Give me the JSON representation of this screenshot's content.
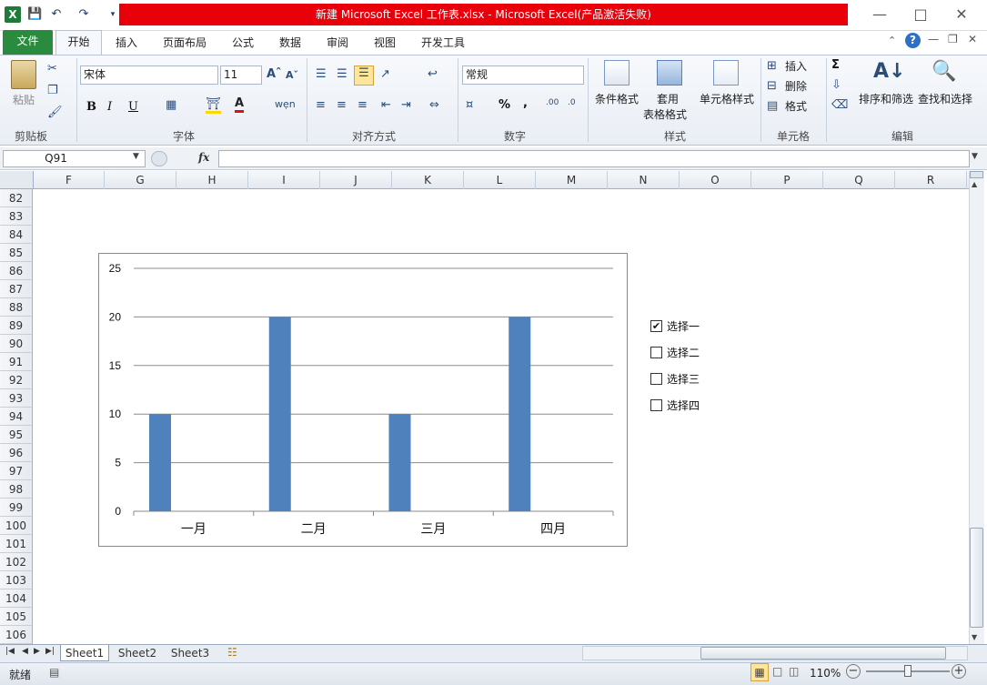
{
  "window": {
    "title": "新建 Microsoft Excel 工作表.xlsx - Microsoft Excel(产品激活失败)"
  },
  "tabs": [
    {
      "label": "文件"
    },
    {
      "label": "开始"
    },
    {
      "label": "插入"
    },
    {
      "label": "页面布局"
    },
    {
      "label": "公式"
    },
    {
      "label": "数据"
    },
    {
      "label": "审阅"
    },
    {
      "label": "视图"
    },
    {
      "label": "开发工具"
    }
  ],
  "ribbon": {
    "clipboard": {
      "paste": "粘贴",
      "group": "剪贴板"
    },
    "font": {
      "name": "宋体",
      "size": "11",
      "bold": "B",
      "italic": "I",
      "underline": "U",
      "group": "字体"
    },
    "align": {
      "group": "对齐方式"
    },
    "number": {
      "format": "常规",
      "percent": "%",
      "comma": ",",
      "group": "数字"
    },
    "styles": {
      "cond": "条件格式",
      "table1": "套用",
      "table2": "表格格式",
      "cell": "单元格样式",
      "group": "样式"
    },
    "cells": {
      "insert": "插入",
      "delete": "删除",
      "format": "格式",
      "group": "单元格"
    },
    "edit": {
      "sort": "排序和筛选",
      "find": "查找和选择",
      "group": "编辑"
    }
  },
  "formula_bar": {
    "name_box": "Q91",
    "fx": "fx",
    "value": ""
  },
  "columns": [
    "F",
    "G",
    "H",
    "I",
    "J",
    "K",
    "L",
    "M",
    "N",
    "O",
    "P",
    "Q",
    "R"
  ],
  "rows": [
    "82",
    "83",
    "84",
    "85",
    "86",
    "87",
    "88",
    "89",
    "90",
    "91",
    "92",
    "93",
    "94",
    "95",
    "96",
    "97",
    "98",
    "99",
    "100",
    "101",
    "102",
    "103",
    "104",
    "105",
    "106"
  ],
  "checkboxes": [
    {
      "label": "选择一",
      "checked": true
    },
    {
      "label": "选择二",
      "checked": false
    },
    {
      "label": "选择三",
      "checked": false
    },
    {
      "label": "选择四",
      "checked": false
    }
  ],
  "sheets": [
    {
      "label": "Sheet1",
      "active": true
    },
    {
      "label": "Sheet2",
      "active": false
    },
    {
      "label": "Sheet3",
      "active": false
    }
  ],
  "status": {
    "ready": "就绪",
    "zoom": "110%"
  },
  "colors": {
    "bar": "#4f81bd",
    "file_tab": "#2a8a3e",
    "title_highlight": "#e8000b"
  },
  "chart_data": {
    "type": "bar",
    "categories": [
      "一月",
      "二月",
      "三月",
      "四月"
    ],
    "values": [
      10,
      20,
      10,
      20
    ],
    "ylim": [
      0,
      25
    ],
    "yticks": [
      0,
      5,
      10,
      15,
      20,
      25
    ],
    "grid": true,
    "title": "",
    "xlabel": "",
    "ylabel": ""
  }
}
